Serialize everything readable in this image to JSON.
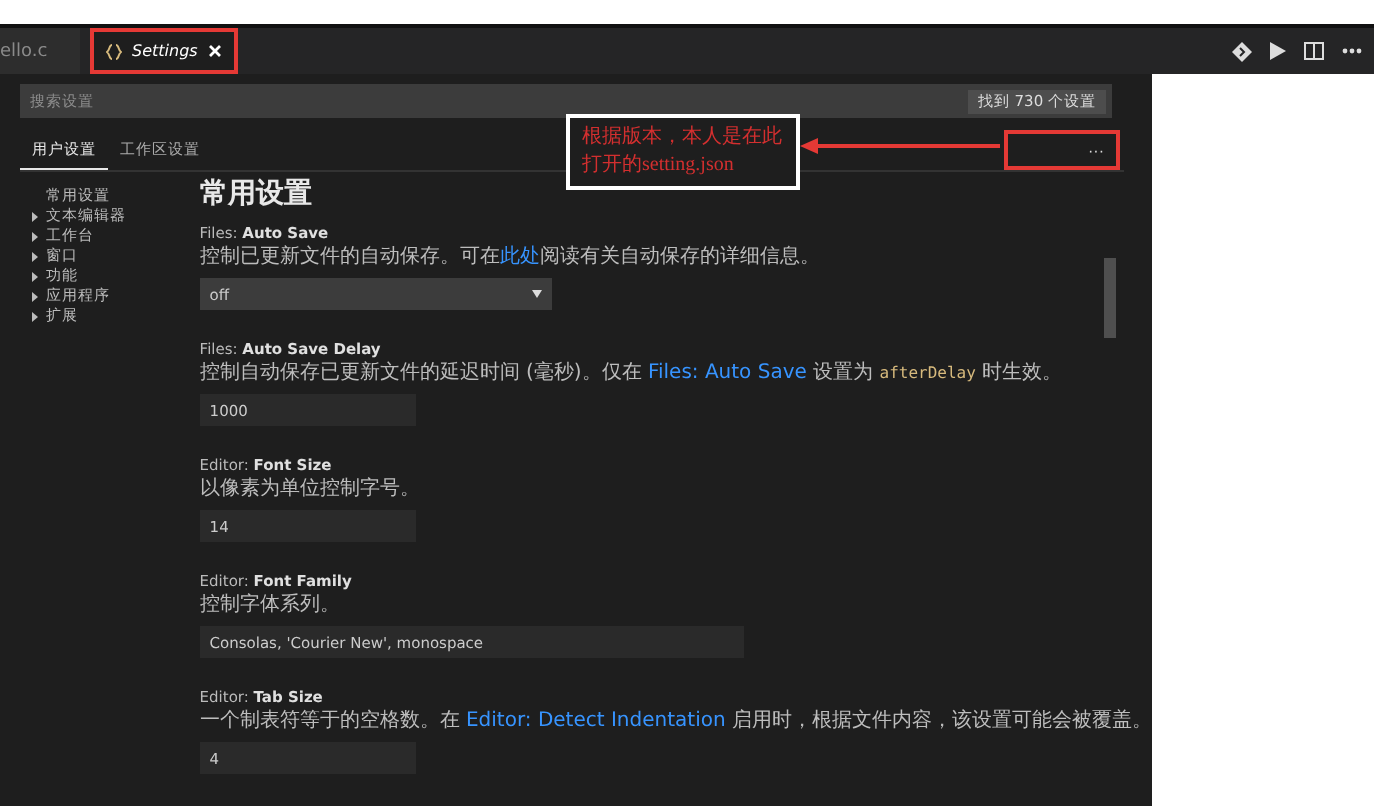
{
  "tabs": [
    {
      "label": "ello.c",
      "selected": false,
      "icon": false,
      "closable": false,
      "highlighted": false
    },
    {
      "label": "Settings",
      "selected": true,
      "icon": true,
      "closable": true,
      "highlighted": true
    }
  ],
  "search": {
    "placeholder": "搜索设置",
    "result": "找到 730 个设置"
  },
  "scope_tabs": [
    {
      "label": "用户设置",
      "selected": true
    },
    {
      "label": "工作区设置",
      "selected": false
    }
  ],
  "more_button": {
    "label": "···",
    "highlighted": true
  },
  "callout": {
    "text": "根据版本，本人是在此打开的setting.json"
  },
  "sidebar": {
    "items": [
      {
        "label": "常用设置",
        "expandable": false
      },
      {
        "label": "文本编辑器",
        "expandable": true
      },
      {
        "label": "工作台",
        "expandable": true
      },
      {
        "label": "窗口",
        "expandable": true
      },
      {
        "label": "功能",
        "expandable": true
      },
      {
        "label": "应用程序",
        "expandable": true
      },
      {
        "label": "扩展",
        "expandable": true
      }
    ]
  },
  "section_title": "常用设置",
  "settings": [
    {
      "title": "Files: **Auto Save**",
      "kind": "select",
      "value": "off",
      "description": [
        {
          "kind": "text",
          "text": "控制已更新文件的自动保存。可在"
        },
        {
          "kind": "link",
          "text": "此处"
        },
        {
          "kind": "text",
          "text": "阅读有关自动保存的详细信息。"
        }
      ]
    },
    {
      "title": "Files: **Auto Save Delay**",
      "kind": "number",
      "value": "1000",
      "description": [
        {
          "kind": "text",
          "text": "控制自动保存已更新文件的延迟时间 (毫秒)。仅在 "
        },
        {
          "kind": "link",
          "text": "Files: Auto Save"
        },
        {
          "kind": "text",
          "text": " 设置为 "
        },
        {
          "kind": "code",
          "text": "afterDelay"
        },
        {
          "kind": "text",
          "text": " 时生效。"
        }
      ]
    },
    {
      "title": "Editor: **Font Size**",
      "kind": "number",
      "value": "14",
      "description": [
        {
          "kind": "text",
          "text": "以像素为单位控制字号。"
        }
      ]
    },
    {
      "title": "Editor: **Font Family**",
      "kind": "text",
      "value": "Consolas, 'Courier New', monospace",
      "description": [
        {
          "kind": "text",
          "text": "控制字体系列。"
        }
      ]
    },
    {
      "title": "Editor: **Tab Size**",
      "kind": "number",
      "value": "4",
      "description": [
        {
          "kind": "text",
          "text": "一个制表符等于的空格数。在 "
        },
        {
          "kind": "link",
          "text": "Editor: Detect Indentation"
        },
        {
          "kind": "text",
          "text": " 启用时，根据文件内容，该设置可能会被覆盖。"
        }
      ]
    }
  ]
}
